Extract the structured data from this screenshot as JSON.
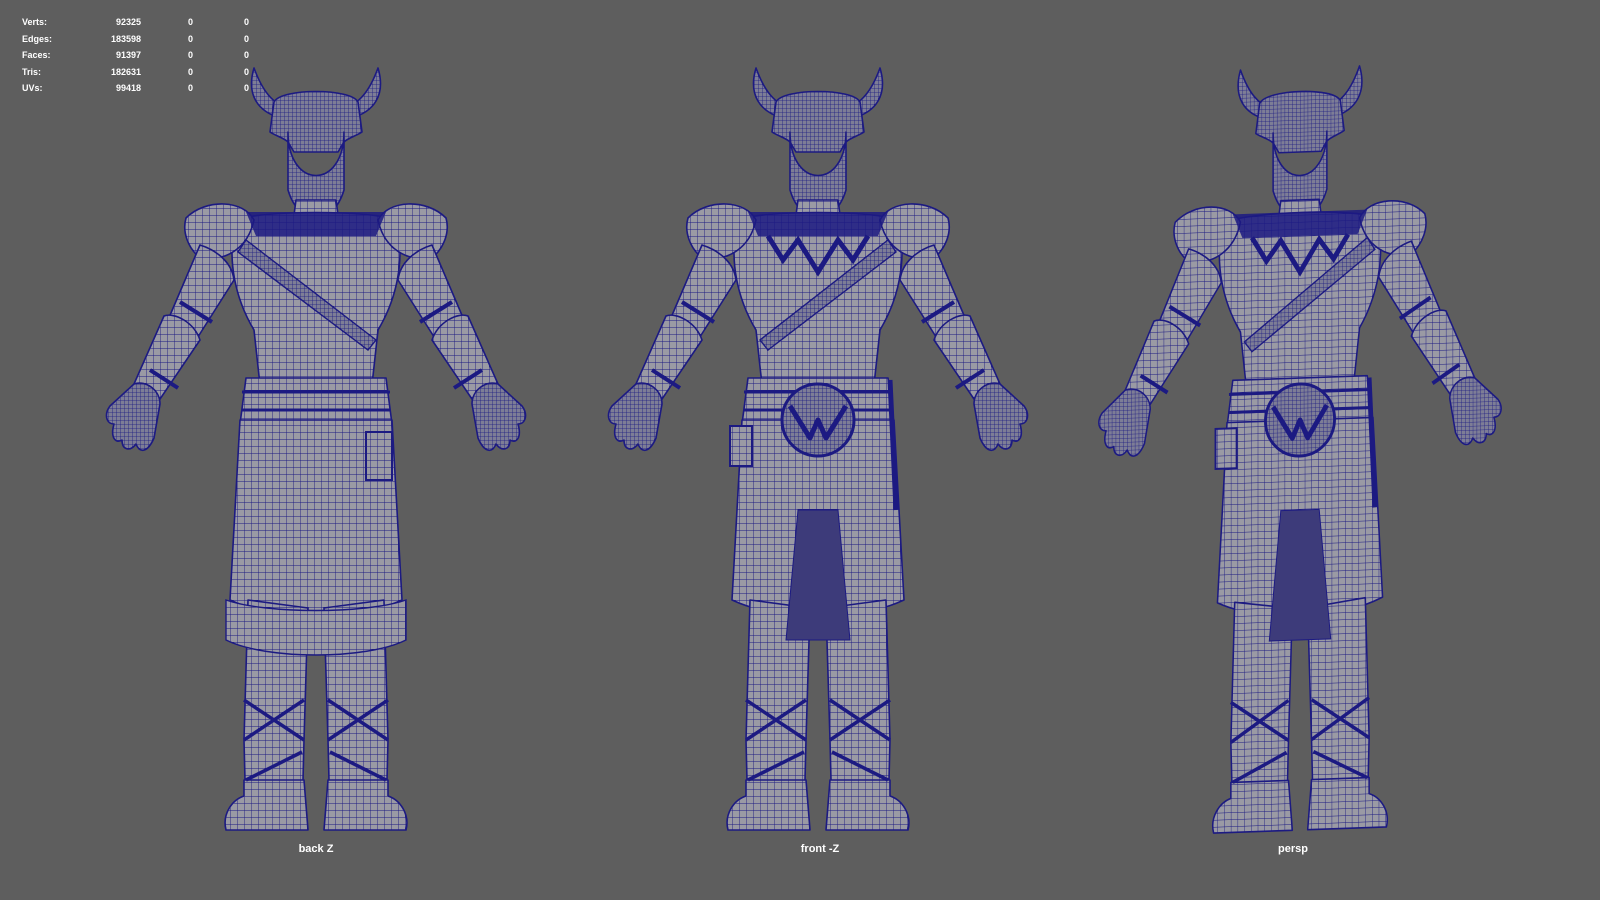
{
  "hud": {
    "rows": [
      {
        "label": "Verts:",
        "v1": "92325",
        "v2": "0",
        "v3": "0"
      },
      {
        "label": "Edges:",
        "v1": "183598",
        "v2": "0",
        "v3": "0"
      },
      {
        "label": "Faces:",
        "v1": "91397",
        "v2": "0",
        "v3": "0"
      },
      {
        "label": "Tris:",
        "v1": "182631",
        "v2": "0",
        "v3": "0"
      },
      {
        "label": "UVs:",
        "v1": "99418",
        "v2": "0",
        "v3": "0"
      }
    ]
  },
  "views": {
    "back": {
      "label": "back Z"
    },
    "front": {
      "label": "front -Z"
    },
    "persp": {
      "label": "persp"
    }
  },
  "colors": {
    "background": "#5e5e5e",
    "mesh_fill": "#9a9aa4",
    "wire": "#1c1a82",
    "hud_text": "#ffffff"
  }
}
